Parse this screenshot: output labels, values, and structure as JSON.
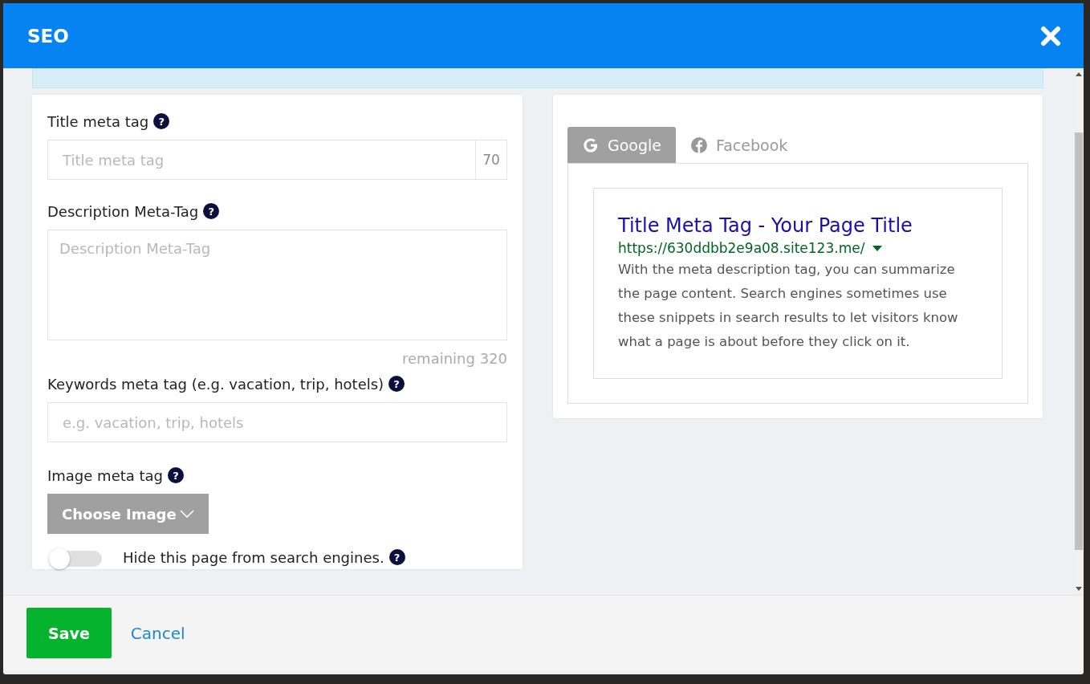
{
  "dialog": {
    "title": "SEO"
  },
  "form": {
    "title_field": {
      "label": "Title meta tag",
      "help": "?",
      "placeholder": "Title meta tag",
      "counter": "70"
    },
    "description_field": {
      "label": "Description Meta-Tag",
      "help": "?",
      "placeholder": "Description Meta-Tag",
      "remaining": "remaining 320"
    },
    "keywords_field": {
      "label": "Keywords meta tag (e.g. vacation, trip, hotels)",
      "help": "?",
      "placeholder": "e.g. vacation, trip, hotels"
    },
    "image_field": {
      "label": "Image meta tag",
      "help": "?",
      "button": "Choose Image"
    },
    "hide_toggle": {
      "label": "Hide this page from search engines.",
      "help": "?",
      "checked": false
    }
  },
  "preview": {
    "tabs": [
      {
        "label": "Google",
        "kind": "google",
        "selected": true
      },
      {
        "label": "Facebook",
        "kind": "facebook",
        "selected": false
      }
    ],
    "result": {
      "title": "Title Meta Tag - Your Page Title",
      "url": "https://630ddbb2e9a08.site123.me/",
      "description": "With the meta description tag, you can summarize the page content. Search engines sometimes use these snippets in search results to let visitors know what a page is about before they click on it."
    }
  },
  "footer": {
    "save": "Save",
    "cancel": "Cancel"
  }
}
